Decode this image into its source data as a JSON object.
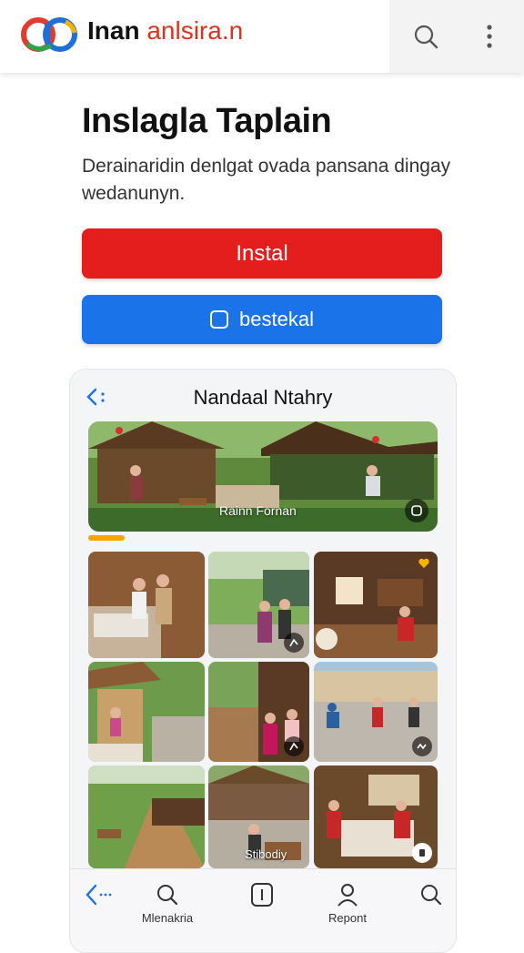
{
  "header": {
    "brand_part1": "Inan",
    "brand_part2": "anlsira.n",
    "logo_icon": "colorful-circles-logo-icon",
    "search_icon": "search-icon",
    "menu_icon": "more-vertical-icon"
  },
  "main": {
    "title": "Inslagla Taplain",
    "description": "Derainaridin denlgat ovada pansana dingay wedanunyn."
  },
  "buttons": {
    "install_label": "Instal",
    "secondary_label": "bestekal",
    "install_color": "#e41d1d",
    "secondary_color": "#1a73e8"
  },
  "preview": {
    "title": "Nandaal Ntahry",
    "hero_label": "Rainn Fornan",
    "tile_label": "Stibodiy"
  },
  "bottom_nav": {
    "items": [
      {
        "label": "",
        "icon": "back-icon"
      },
      {
        "label": "Mlenakria",
        "icon": "search-icon"
      },
      {
        "label": "",
        "icon": "info-icon"
      },
      {
        "label": "Repont",
        "icon": "user-icon"
      },
      {
        "label": "",
        "icon": "search-icon"
      }
    ]
  }
}
